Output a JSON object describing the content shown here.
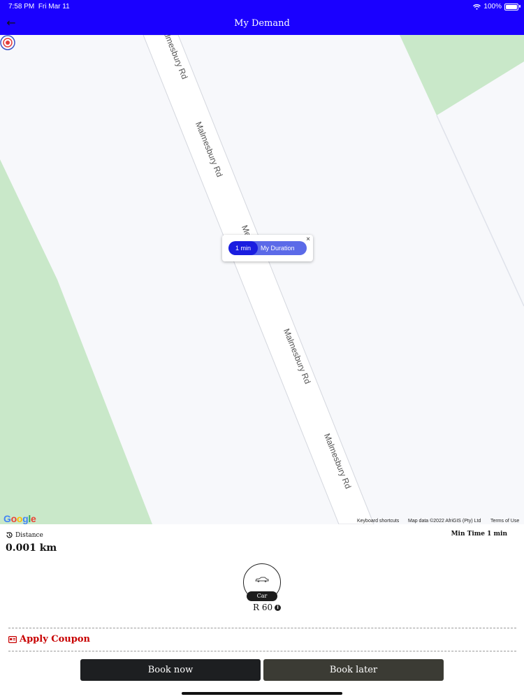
{
  "status_bar": {
    "time": "7:58 PM",
    "date": "Fri Mar 11",
    "battery": "100%"
  },
  "header": {
    "title": "My Demand",
    "back_icon": "back-arrow-icon"
  },
  "map": {
    "road_labels": [
      "Malmesbury Rd",
      "Malmesbury Rd",
      "Me",
      "Malmesbury Rd",
      "Malmesbury Rd"
    ],
    "popup": {
      "duration": "1 min",
      "label": "My Duration",
      "close": "×"
    },
    "google_logo": "Google",
    "attribution": {
      "keyboard": "Keyboard shortcuts",
      "map_data": "Map data ©2022 AfriGIS (Pty) Ltd",
      "terms": "Terms of Use"
    }
  },
  "trip": {
    "distance_label": "Distance",
    "distance_value": "0.001 km",
    "min_time": "Min Time 1 min"
  },
  "vehicle": {
    "name": "Car",
    "price": "R 60"
  },
  "coupon": {
    "label": "Apply Coupon"
  },
  "actions": {
    "book_now": "Book now",
    "book_later": "Book later"
  },
  "colors": {
    "header": "#1a00ff",
    "coupon": "#c80000",
    "park": "#c9e8c9",
    "map_bg": "#f7f8fb"
  }
}
